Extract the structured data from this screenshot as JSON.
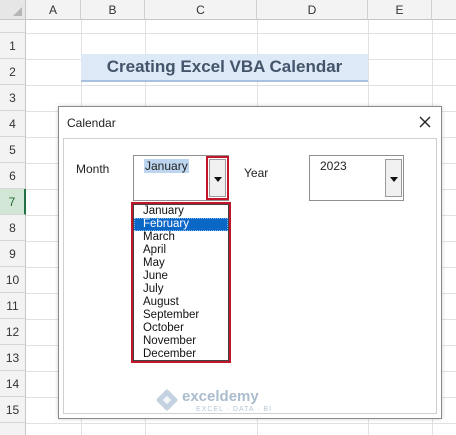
{
  "sheet": {
    "columns": [
      "A",
      "B",
      "C",
      "D",
      "E"
    ],
    "rows": [
      "1",
      "2",
      "3",
      "4",
      "5",
      "6",
      "7",
      "8",
      "9",
      "10",
      "11",
      "12",
      "13",
      "14",
      "15"
    ],
    "active_row": "7",
    "title_cell": "Creating Excel VBA Calendar"
  },
  "dialog": {
    "title": "Calendar",
    "month": {
      "label": "Month",
      "value": "January",
      "options": [
        "January",
        "February",
        "March",
        "April",
        "May",
        "June",
        "July",
        "August",
        "September",
        "October",
        "November",
        "December"
      ],
      "highlighted": "February"
    },
    "year": {
      "label": "Year",
      "value": "2023"
    }
  },
  "watermark": {
    "name": "exceldemy",
    "tagline": "EXCEL · DATA · BI"
  },
  "colors": {
    "accent": "#0a66c7",
    "highlight_outline": "#c0152a",
    "excel_green": "#217346"
  }
}
